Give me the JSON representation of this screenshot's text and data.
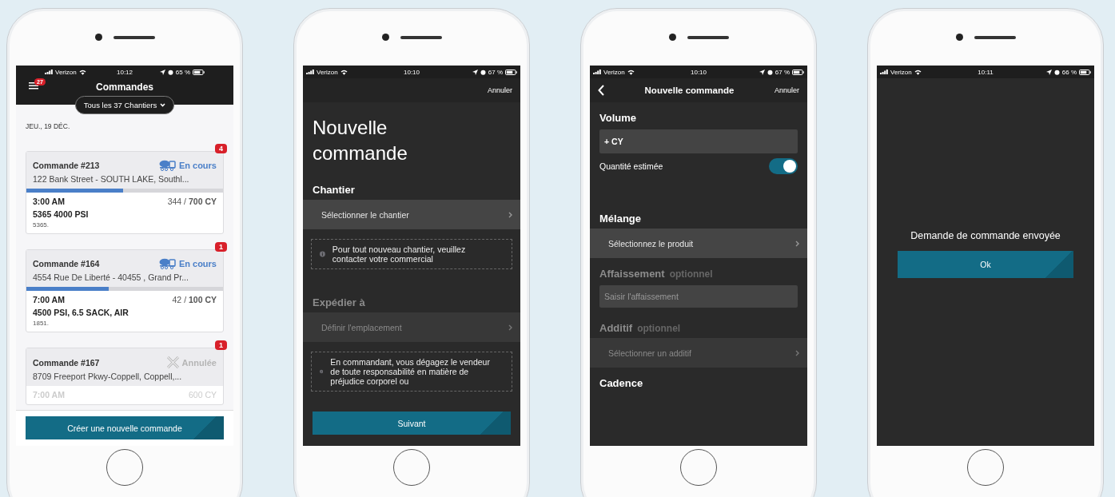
{
  "phones": [
    {
      "kind": "orders",
      "status": {
        "carrier": "Verizon",
        "time": "10:12",
        "battery": "65 %"
      },
      "menu_badge": "27",
      "title": "Commandes",
      "filter": "Tous les 37 Chantiers",
      "date": "JEU., 19 DÉC.",
      "orders": [
        {
          "title": "Commande #213",
          "badge": "4",
          "kind": "in_progress",
          "state_label": "En cours",
          "address": "122 Bank Street - SOUTH LAKE,  Southl...",
          "level": 0.49,
          "time": "3:00 AM",
          "quantity": "344 / **700 CY**",
          "product": "5365 4000 PSI",
          "note": "5365."
        },
        {
          "title": "Commande #164",
          "badge": "1",
          "kind": "in_progress",
          "state_label": "En cours",
          "address": "4554 Rue De Liberté - 40455 ,  Grand Pr...",
          "level": 0.42,
          "time": "7:00 AM",
          "quantity": "42 / **100 CY**",
          "product": "4500 PSI, 6.5 SACK, AIR",
          "note": "1851."
        },
        {
          "title": "Commande #167",
          "badge": "1",
          "kind": "cancelled",
          "state_label": "Annulée",
          "address": "8709  Freeport Pkwy-Coppell,  Coppell,...",
          "time": "7:00 AM",
          "quantity": "600 CY"
        }
      ],
      "button": "Créer une nouvelle commande"
    },
    {
      "kind": "form",
      "status": {
        "carrier": "Verizon",
        "time": "10:10",
        "battery": "67 %"
      },
      "cancel": "Annuler",
      "heading": "Nouvelle commande",
      "items": [
        {
          "kind": "section",
          "label": "Chantier",
          "disabled": false
        },
        {
          "kind": "select",
          "label": "Sélectionner le chantier",
          "disabled": false
        },
        {
          "kind": "note",
          "text": "Pour tout nouveau chantier, veuillez contacter votre commercial"
        },
        {
          "kind": "section",
          "label": "Expédier à",
          "disabled": true
        },
        {
          "kind": "select",
          "label": "Définir l'emplacement",
          "disabled": true
        },
        {
          "kind": "note",
          "text": "En commandant, vous dégagez le vendeur de toute responsabilité en matière de préjudice corporel ou"
        }
      ],
      "button": "Suivant"
    },
    {
      "kind": "form",
      "status": {
        "carrier": "Verizon",
        "time": "10:10",
        "battery": "67 %"
      },
      "title": "Nouvelle commande",
      "cancel": "Annuler",
      "items": [
        {
          "kind": "section",
          "label": "Volume",
          "disabled": false
        },
        {
          "kind": "input",
          "value": "+ CY"
        },
        {
          "kind": "toggle",
          "label": "Quantité estimée",
          "on": true
        },
        {
          "kind": "section",
          "label": "Mélange",
          "disabled": false
        },
        {
          "kind": "select",
          "label": "Sélectionnez le produit",
          "disabled": false
        },
        {
          "kind": "section",
          "label": "Affaissement",
          "optional": "optionnel",
          "disabled": true
        },
        {
          "kind": "input",
          "placeholder": "Saisir l'affaissement"
        },
        {
          "kind": "section",
          "label": "Additif",
          "optional": "optionnel",
          "disabled": true
        },
        {
          "kind": "select",
          "label": "Sélectionner un additif",
          "disabled": true
        },
        {
          "kind": "section",
          "label": "Cadence",
          "disabled": false
        }
      ]
    },
    {
      "kind": "message",
      "status": {
        "carrier": "Verizon",
        "time": "10:11",
        "battery": "66 %"
      },
      "message": "Demande de commande envoyée",
      "button": "Ok"
    }
  ]
}
